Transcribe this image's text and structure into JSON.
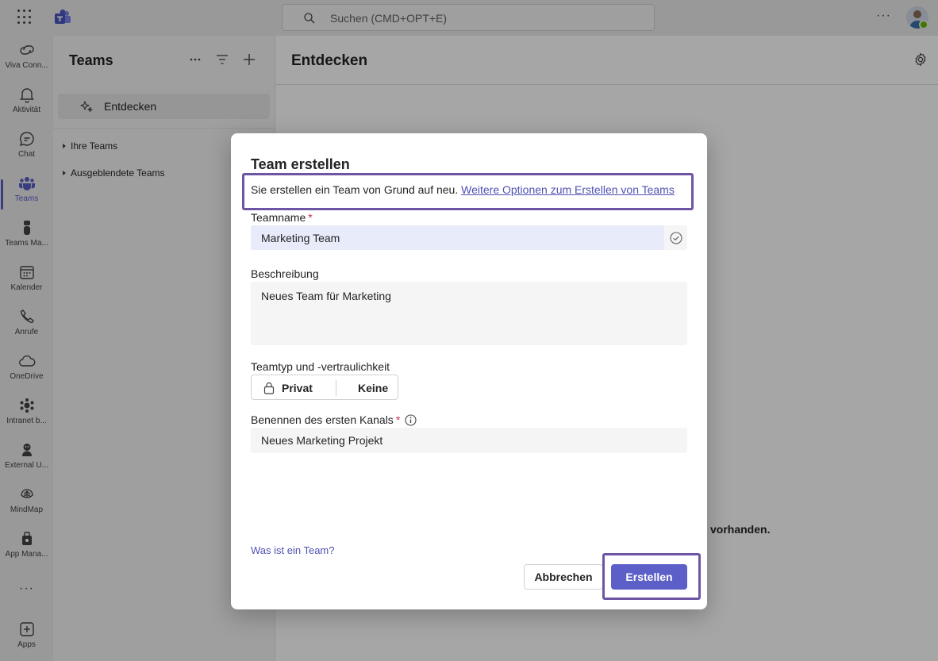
{
  "topbar": {
    "search_placeholder": "Suchen (CMD+OPT+E)",
    "more": "···"
  },
  "rail": {
    "items": [
      {
        "label": "Viva Conn...",
        "icon": "viva-connections-icon"
      },
      {
        "label": "Aktivität",
        "icon": "bell-icon"
      },
      {
        "label": "Chat",
        "icon": "chat-icon"
      },
      {
        "label": "Teams",
        "icon": "teams-icon",
        "active": true
      },
      {
        "label": "Teams Ma...",
        "icon": "teams-manager-icon"
      },
      {
        "label": "Kalender",
        "icon": "calendar-icon"
      },
      {
        "label": "Anrufe",
        "icon": "phone-icon"
      },
      {
        "label": "OneDrive",
        "icon": "cloud-icon"
      },
      {
        "label": "Intranet b...",
        "icon": "intranet-icon"
      },
      {
        "label": "External U...",
        "icon": "external-user-icon"
      },
      {
        "label": "MindMap",
        "icon": "mindmap-icon"
      },
      {
        "label": "App Mana...",
        "icon": "app-manager-icon"
      },
      {
        "label": "···",
        "icon": "more-apps-icon"
      },
      {
        "label": "Apps",
        "icon": "add-apps-icon"
      }
    ]
  },
  "panel": {
    "title": "Teams",
    "discover_label": "Entdecken",
    "groups": [
      "Ihre Teams",
      "Ausgeblendete Teams"
    ]
  },
  "main": {
    "title": "Entdecken",
    "behind_text": "vorhanden."
  },
  "dialog": {
    "title": "Team erstellen",
    "intro_text": "Sie erstellen ein Team von Grund auf neu. ",
    "intro_link": "Weitere Optionen zum Erstellen von Teams",
    "team_name_label": "Teamname",
    "team_name_value": "Marketing Team",
    "description_label": "Beschreibung",
    "description_value": "Neues Team für Marketing",
    "type_label": "Teamtyp und -vertraulichkeit",
    "privacy_value": "Privat",
    "sensitivity_value": "Keine",
    "channel_label": "Benennen des ersten Kanals",
    "channel_value": "Neues Marketing Projekt",
    "required_marker": "*",
    "what_is_team_link": "Was ist ein Team?",
    "cancel_label": "Abbrechen",
    "create_label": "Erstellen"
  },
  "colors": {
    "accent": "#5b5fc7",
    "highlight_border": "#6e55a3",
    "link": "#4f52b2",
    "required": "#c4314b"
  }
}
